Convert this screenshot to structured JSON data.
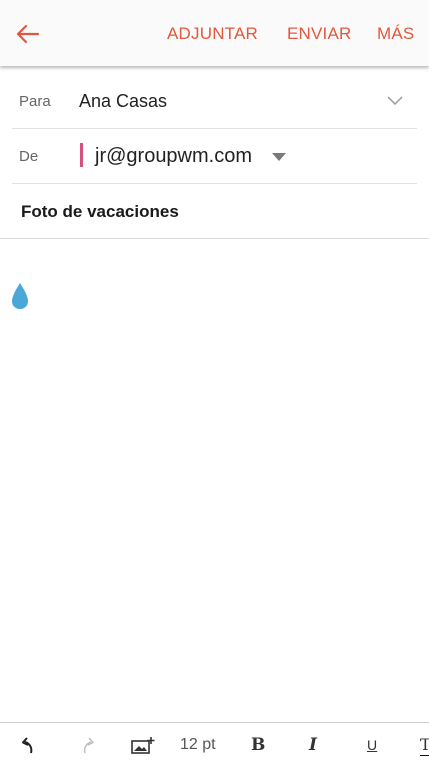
{
  "topbar": {
    "back_icon": "arrow-left-icon",
    "actions": {
      "attach": "ADJUNTAR",
      "send": "ENVIAR",
      "more": "MÁS"
    },
    "accent_color": "#e2583e"
  },
  "fields": {
    "to": {
      "label": "Para",
      "value": "Ana Casas",
      "icon": "chevron-down-icon"
    },
    "from": {
      "label": "De",
      "value": "jr@groupwm.com",
      "account_color": "#d4507e",
      "icon": "caret-down-icon"
    },
    "subject": {
      "value": "Foto de vacaciones"
    }
  },
  "body": {
    "text": "",
    "cursor_icon": "text-cursor-handle-icon",
    "cursor_color": "#4aa8d8"
  },
  "format_toolbar": {
    "undo_icon": "undo-icon",
    "redo_icon": "redo-icon",
    "image_icon": "insert-image-icon",
    "font_size": "12 pt",
    "bold": "B",
    "italic": "I",
    "underline": "U",
    "text_color": "T"
  }
}
